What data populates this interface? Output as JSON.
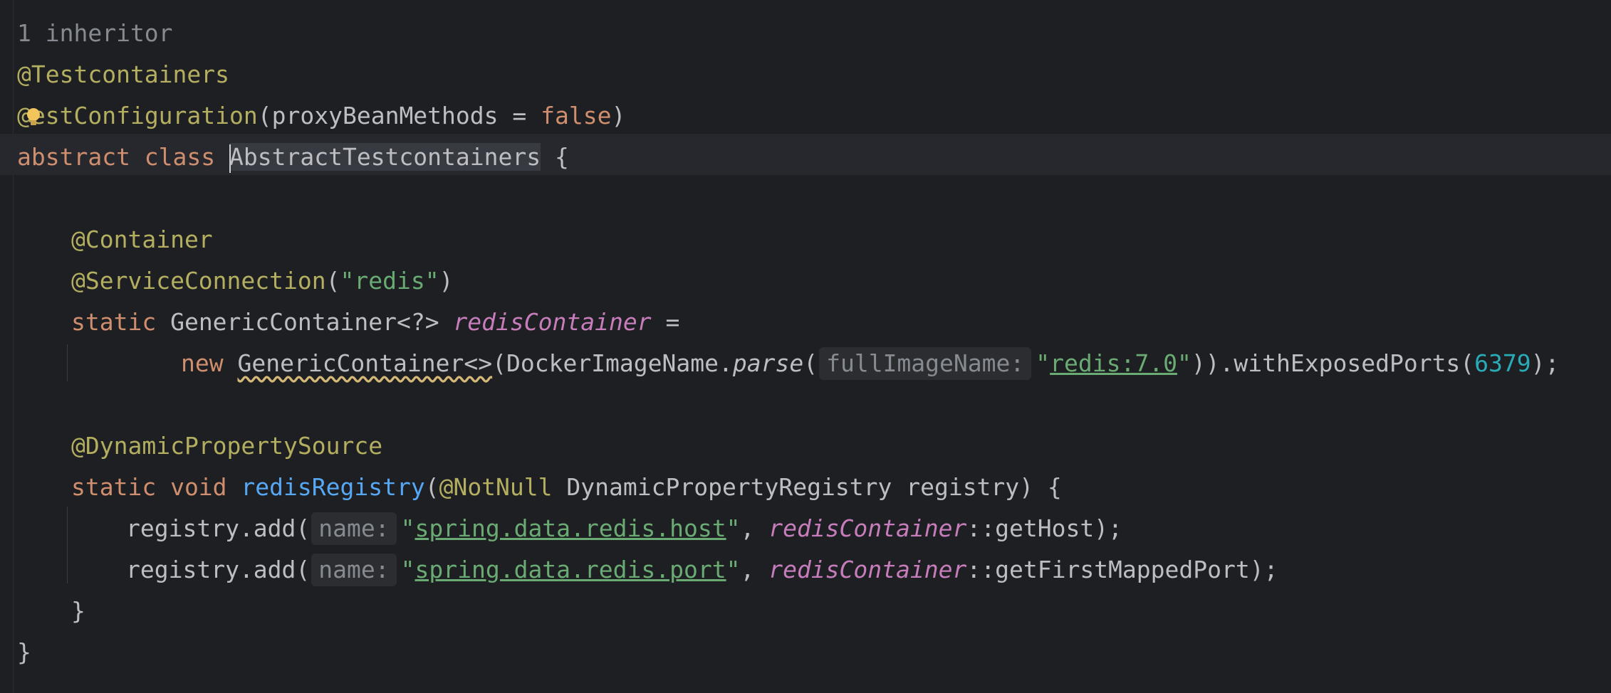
{
  "editor": {
    "inheritor_hint": "1 inheritor",
    "lines": {
      "l2_ann": "@Testcontainers",
      "l3_at": "@",
      "l3_ann": "estConfiguration",
      "l3_open": "(proxyBeanMethods = ",
      "l3_false": "false",
      "l3_close": ")",
      "l4_kw": "abstract class ",
      "l4_ident": "AbstractTestcontainers",
      "l4_brace": " {",
      "l6_ann": "@Container",
      "l7_ann": "@ServiceConnection",
      "l7_open": "(",
      "l7_str": "\"redis\"",
      "l7_close": ")",
      "l8_kw": "static ",
      "l8_type": "GenericContainer<?> ",
      "l8_field": "redisContainer",
      "l8_eq": " =",
      "l9_new": "new ",
      "l9_type": "GenericContainer<>",
      "l9_call": "(DockerImageName.",
      "l9_parse": "parse",
      "l9_paren": "(",
      "l9_hint": "fullImageName:",
      "l9_q1": "\"",
      "l9_str": "redis:7.0",
      "l9_q2": "\"",
      "l9_rest": ")).withExposedPorts(",
      "l9_num": "6379",
      "l9_end": ");",
      "l11_ann": "@DynamicPropertySource",
      "l12_kw": "static void ",
      "l12_method": "redisRegistry",
      "l12_open": "(",
      "l12_ann": "@NotNull",
      "l12_rest": " DynamicPropertyRegistry registry) {",
      "l13_call": "registry.add(",
      "l13_hint": "name:",
      "l13_q1": "\"",
      "l13_str": "spring.data.redis.host",
      "l13_q2": "\"",
      "l13_comma": ", ",
      "l13_field": "redisContainer",
      "l13_end": "::getHost);",
      "l14_call": "registry.add(",
      "l14_hint": "name:",
      "l14_q1": "\"",
      "l14_str": "spring.data.redis.port",
      "l14_q2": "\"",
      "l14_comma": ", ",
      "l14_field": "redisContainer",
      "l14_end": "::getFirstMappedPort);",
      "l15_brace": "}",
      "l16_brace": "}"
    }
  },
  "colors": {
    "background": "#1e1f22",
    "annotation": "#b3ae60",
    "keyword": "#cf8e6d",
    "string": "#6aab73",
    "field": "#c77dbb",
    "method": "#56a8f5",
    "number": "#2aacb8"
  },
  "icons": {
    "intention_bulb": "lightbulb-icon"
  }
}
